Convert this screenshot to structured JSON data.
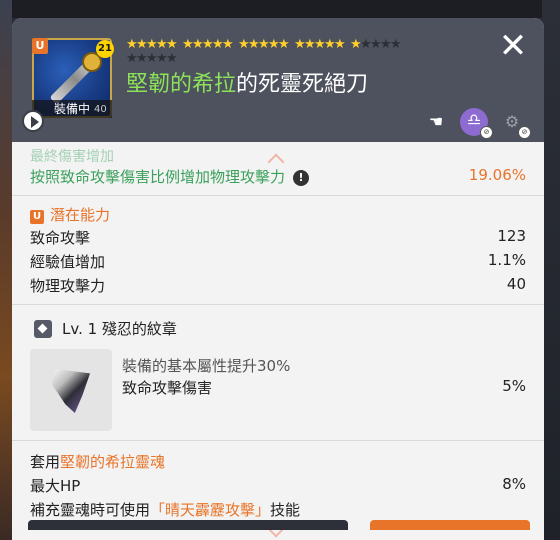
{
  "item": {
    "name_accent": "堅韌的希拉",
    "name_rest": "的死靈死絕刀",
    "equipped_label": "裝備中",
    "level_badge": "21",
    "unique_badge": "U",
    "level_faint": "40"
  },
  "stars": {
    "filled": 21,
    "total": 30
  },
  "header_icons": [
    "hand-icon",
    "libra-icon",
    "gear-locked-icon"
  ],
  "close_label": "✕",
  "stats": {
    "cut_text": "最終傷害增加",
    "crit_row": {
      "label": "按照致命攻擊傷害比例增加物理攻擊力",
      "value": "19.06%",
      "info": "!"
    }
  },
  "potential": {
    "badge": "U",
    "title": "潛在能力",
    "rows": [
      {
        "label": "致命攻擊",
        "value": "123"
      },
      {
        "label": "經驗值增加",
        "value": "1.1%"
      },
      {
        "label": "物理攻擊力",
        "value": "40"
      }
    ]
  },
  "emblem": {
    "title": "Lv. 1 殘忍的紋章",
    "desc": "裝備的基本屬性提升30%",
    "stat_label": "致命攻擊傷害",
    "stat_value": "5%"
  },
  "soul": {
    "prefix": "套用",
    "name": "堅韌的希拉靈魂",
    "hp_label": "最大HP",
    "hp_value": "8%",
    "skill_prefix": "補充靈魂時可使用",
    "skill_name": "「晴天霹靂攻擊」",
    "skill_suffix": "技能"
  },
  "colors": {
    "accent_green": "#3aa05b",
    "accent_orange": "#e8742a",
    "header_bg": "#4d525e",
    "star_gold": "#ffd02a"
  }
}
